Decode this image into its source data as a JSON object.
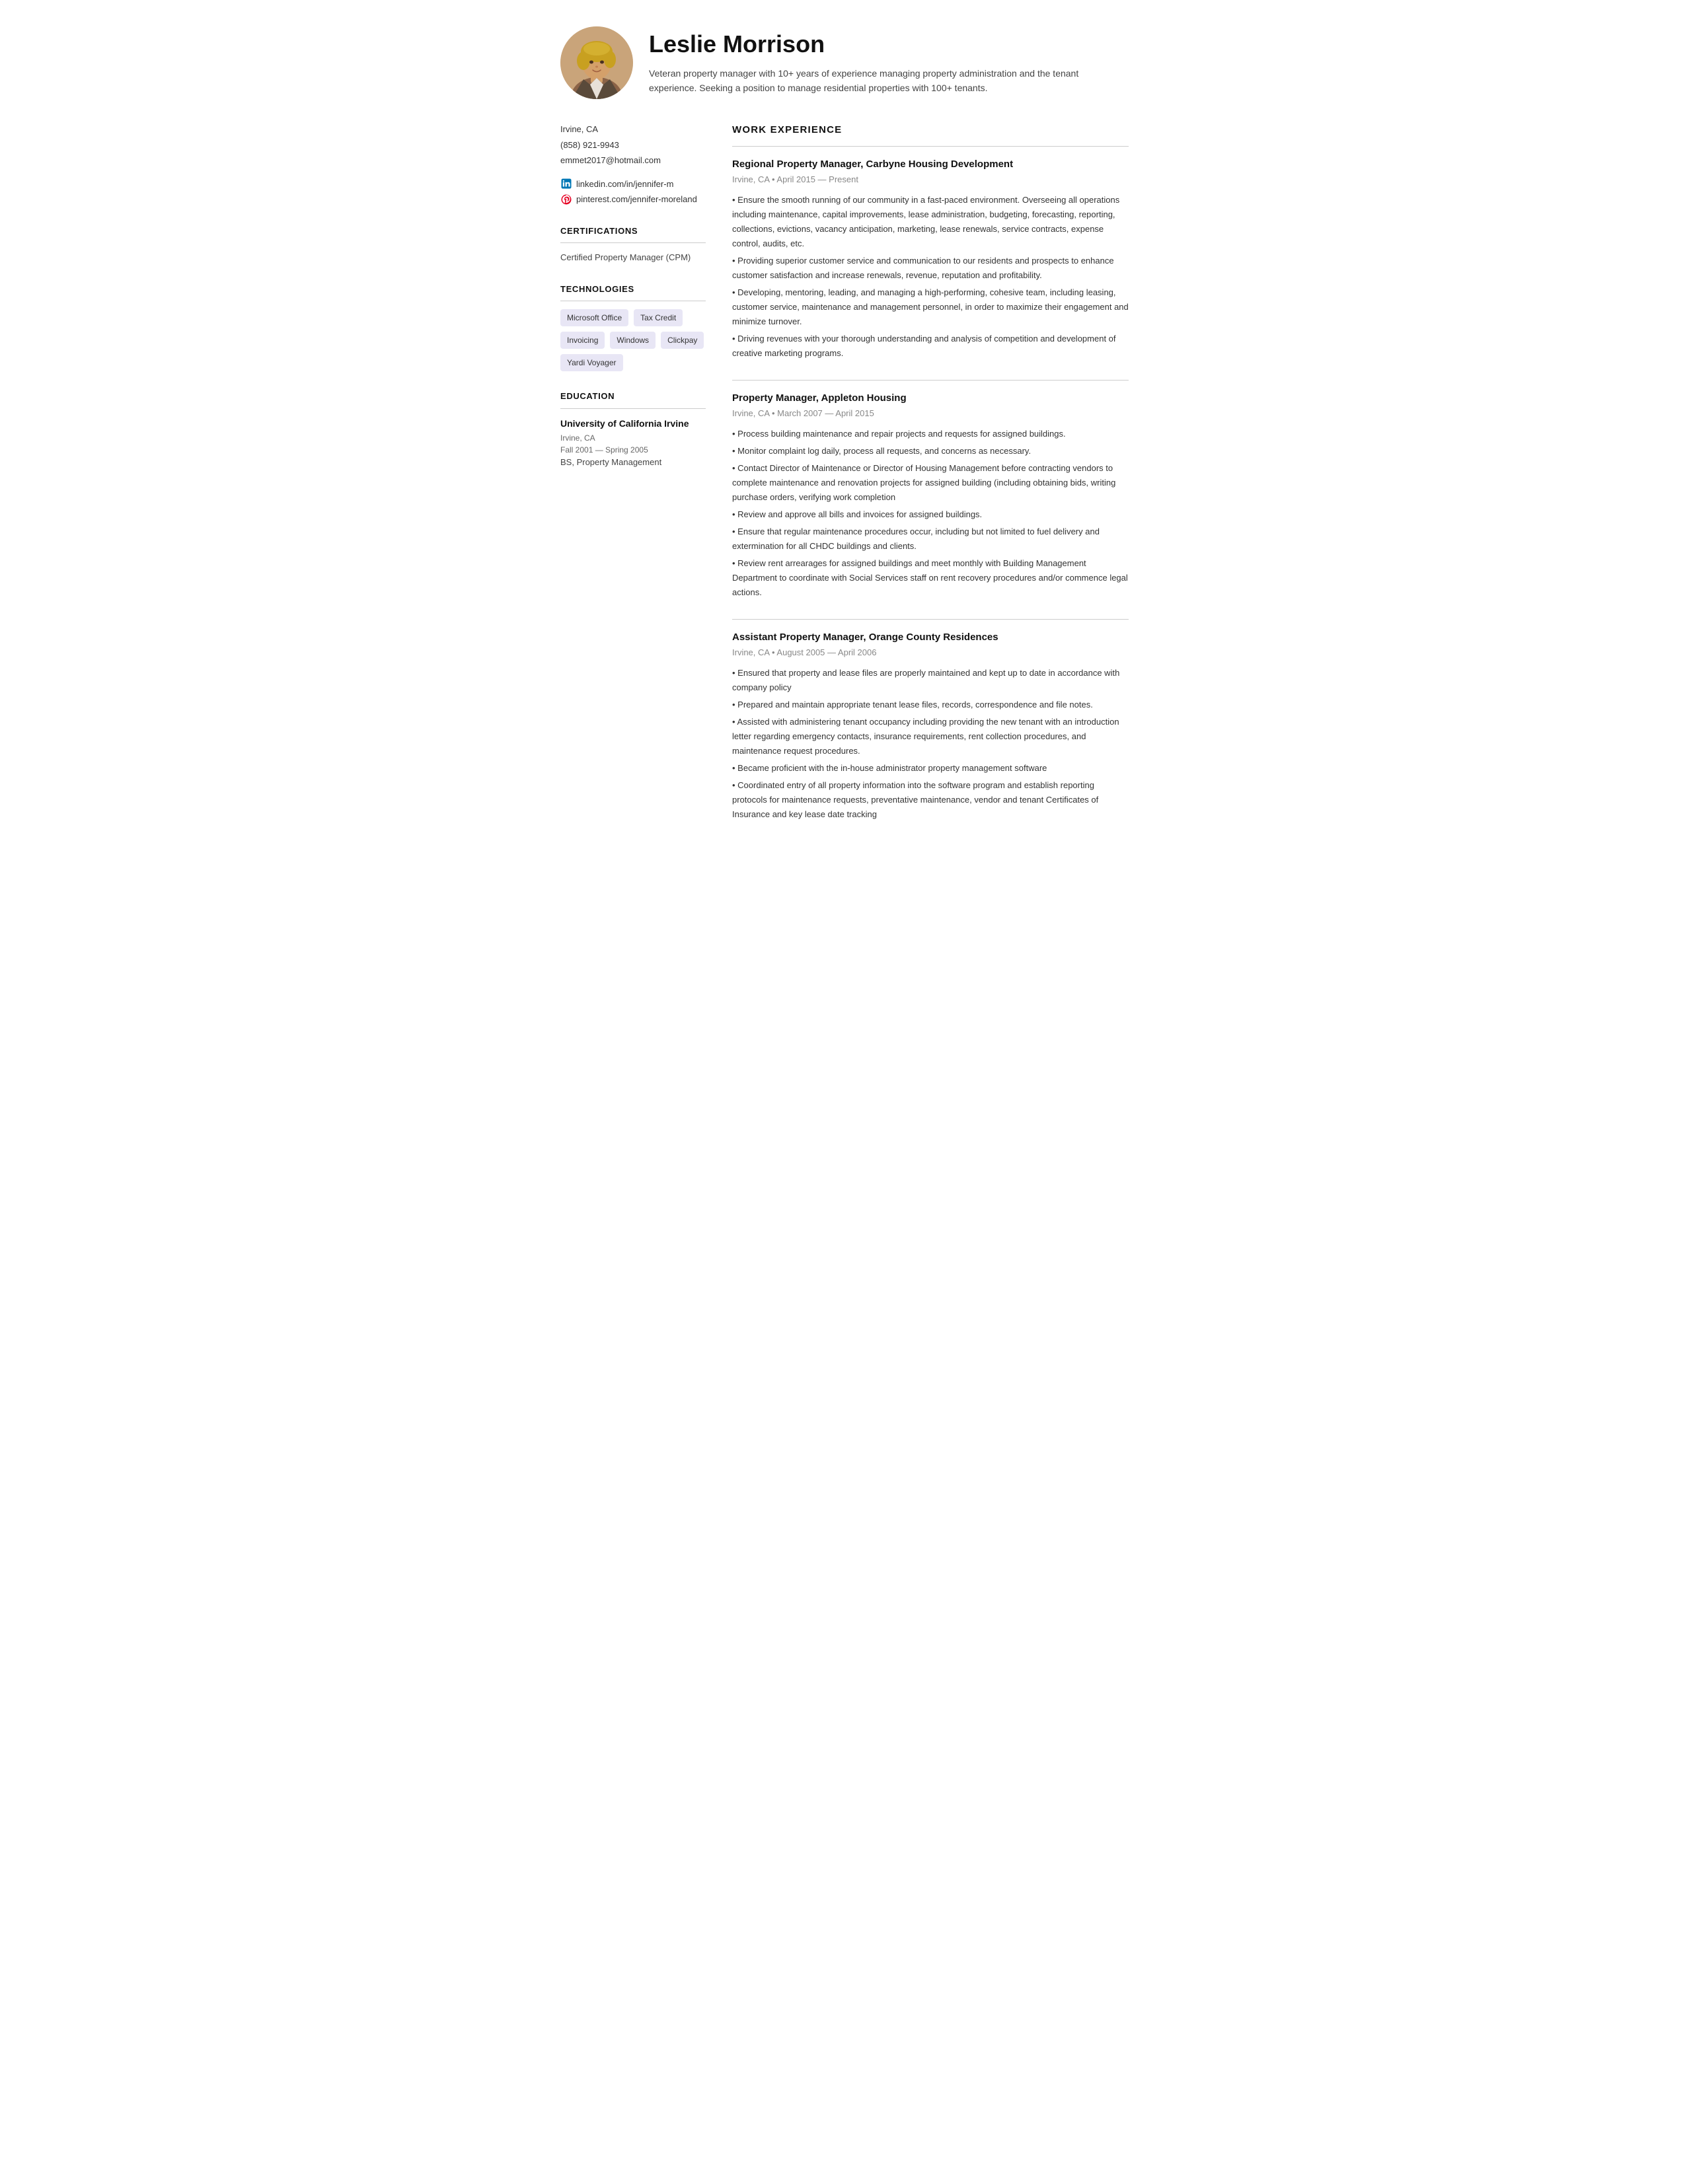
{
  "header": {
    "name": "Leslie Morrison",
    "summary": "Veteran property manager with 10+ years of experience managing property administration and the tenant experience. Seeking a position to manage residential properties with 100+ tenants."
  },
  "contact": {
    "location": "Irvine, CA",
    "phone": "(858) 921-9943",
    "email": "emmet2017@hotmail.com",
    "linkedin": "linkedin.com/in/jennifer-m",
    "pinterest": "pinterest.com/jennifer-moreland"
  },
  "certifications": {
    "title": "CERTIFICATIONS",
    "items": [
      "Certified Property Manager (CPM)"
    ]
  },
  "technologies": {
    "title": "TECHNOLOGIES",
    "items": [
      "Microsoft Office",
      "Tax Credit",
      "Invoicing",
      "Windows",
      "Clickpay",
      "Yardi Voyager"
    ]
  },
  "education": {
    "title": "EDUCATION",
    "items": [
      {
        "school": "University of California Irvine",
        "location": "Irvine, CA",
        "dates": "Fall 2001 — Spring 2005",
        "degree": "BS, Property Management"
      }
    ]
  },
  "work_experience": {
    "title": "WORK EXPERIENCE",
    "jobs": [
      {
        "title": "Regional Property Manager, Carbyne Housing Development",
        "meta": "Irvine, CA • April 2015 — Present",
        "bullets": [
          "• Ensure the smooth running of our community in a fast-paced environment. Overseeing all operations including maintenance, capital improvements, lease administration, budgeting, forecasting, reporting, collections, evictions, vacancy anticipation, marketing, lease renewals, service contracts, expense control, audits, etc.",
          "• Providing superior customer service and communication to our residents and prospects to enhance customer satisfaction and increase renewals, revenue, reputation and profitability.",
          "• Developing, mentoring, leading, and managing a high-performing, cohesive team, including leasing, customer service, maintenance and management personnel, in order to maximize their engagement and minimize turnover.",
          "• Driving revenues with your thorough understanding and analysis of competition and development of creative marketing programs."
        ]
      },
      {
        "title": "Property Manager, Appleton Housing",
        "meta": "Irvine, CA • March 2007 — April 2015",
        "bullets": [
          "• Process building maintenance and repair projects and requests for assigned buildings.",
          "• Monitor complaint log daily, process all requests, and concerns as necessary.",
          "• Contact Director of Maintenance or Director of Housing Management before contracting vendors to complete maintenance and renovation projects for assigned building (including obtaining bids, writing purchase orders, verifying work completion",
          "• Review and approve all bills and invoices for assigned buildings.",
          "• Ensure that regular maintenance procedures occur, including but not limited to fuel delivery and extermination for all CHDC buildings and clients.",
          "• Review rent arrearages for assigned buildings and meet monthly with Building Management Department to coordinate with Social Services staff on rent recovery procedures and/or commence legal actions."
        ]
      },
      {
        "title": "Assistant Property Manager, Orange County Residences",
        "meta": "Irvine, CA • August 2005 — April 2006",
        "bullets": [
          "• Ensured that property and lease files are properly maintained and kept up to date in accordance with company policy",
          "• Prepared and maintain appropriate tenant lease files, records, correspondence and file notes.",
          "• Assisted with administering tenant occupancy including providing the new tenant with an introduction letter regarding emergency contacts, insurance requirements, rent collection procedures, and maintenance request procedures.",
          "• Became proficient with the in-house administrator property management software",
          "• Coordinated entry of all property information into the software program and establish reporting protocols for maintenance requests, preventative maintenance, vendor and tenant Certificates of Insurance and key lease date tracking"
        ]
      }
    ]
  }
}
